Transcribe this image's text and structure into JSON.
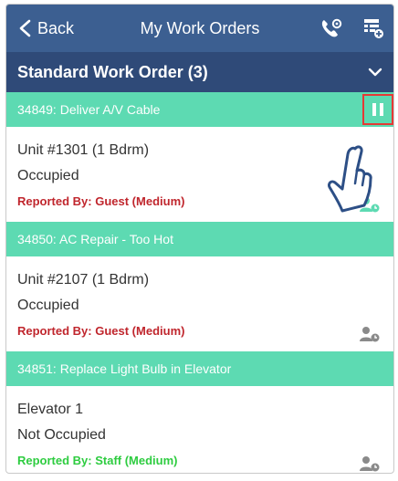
{
  "header": {
    "back_label": "Back",
    "title": "My Work Orders",
    "icons": [
      "phone-settings-icon",
      "add-list-icon"
    ]
  },
  "section": {
    "title": "Standard Work Order (3)",
    "toggle_icon": "chevron-down-icon"
  },
  "colors": {
    "topbar": "#3c5f91",
    "section": "#2f4a78",
    "wo_header": "#5ddab2",
    "guest": "#c0262d",
    "staff": "#2ecc40"
  },
  "work_orders": [
    {
      "header": "34849: Deliver A/V Cable",
      "unit": "Unit #1301 (1 Bdrm)",
      "occupancy": "Occupied",
      "reported": "Reported By: Guest  (Medium)",
      "reporter_type": "guest",
      "assignee_icon": "user-green-icon",
      "action_icon": "pause-icon"
    },
    {
      "header": "34850: AC Repair - Too Hot",
      "unit": "Unit #2107 (1 Bdrm)",
      "occupancy": "Occupied",
      "reported": "Reported By: Guest  (Medium)",
      "reporter_type": "guest",
      "assignee_icon": "user-gray-icon"
    },
    {
      "header": "34851: Replace Light Bulb in Elevator",
      "unit": "Elevator 1",
      "occupancy": "Not Occupied",
      "reported": "Reported By: Staff  (Medium)",
      "reporter_type": "staff",
      "assignee_icon": "user-gray-icon"
    }
  ]
}
